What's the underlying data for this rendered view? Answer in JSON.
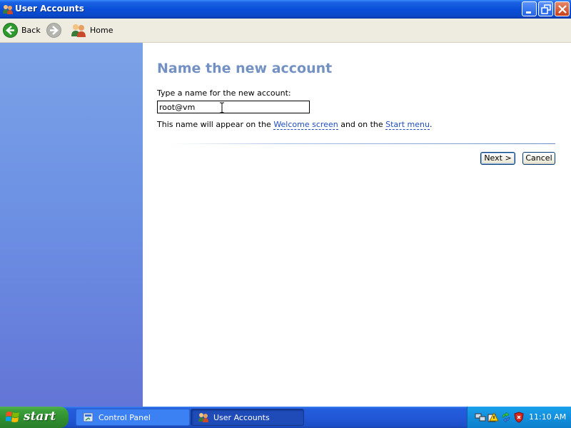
{
  "window": {
    "title": "User Accounts"
  },
  "toolbar": {
    "back_label": "Back",
    "home_label": "Home"
  },
  "page": {
    "heading": "Name the new account",
    "prompt": "Type a name for the new account:",
    "name_value": "root@vm",
    "hint_before": "This name will appear on the ",
    "hint_link1": "Welcome screen",
    "hint_middle": " and on the ",
    "hint_link2": "Start menu",
    "hint_after": ".",
    "next_label": "Next >",
    "cancel_label": "Cancel"
  },
  "taskbar": {
    "start_label": "start",
    "tasks": [
      {
        "label": "Control Panel",
        "icon": "control-panel-icon",
        "active": false
      },
      {
        "label": "User Accounts",
        "icon": "user-accounts-icon",
        "active": true
      }
    ],
    "clock": "11:10 AM"
  },
  "colors": {
    "heading": "#7491c4",
    "link": "#1e4cc0",
    "left_panel_top": "#7ba2e7",
    "left_panel_bottom": "#6375d6"
  }
}
